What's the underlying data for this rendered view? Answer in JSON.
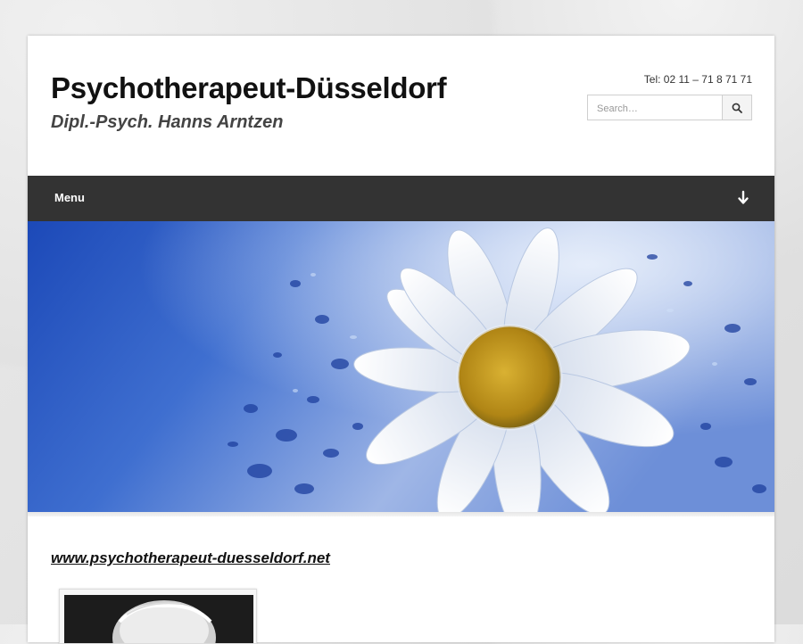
{
  "header": {
    "site_title": "Psychotherapeut-Düsseldorf",
    "site_description": "Dipl.-Psych. Hanns Arntzen",
    "phone": "Tel: 02 11 – 71 8 71 71"
  },
  "search": {
    "placeholder": "Search…",
    "value": "",
    "button_icon": "search-icon"
  },
  "nav": {
    "menu_label": "Menu",
    "toggle_icon": "arrow-down-icon"
  },
  "hero": {
    "image": "white-daisy-on-blue-water-drops"
  },
  "content": {
    "site_link": "www.psychotherapeut-duesseldorf.net",
    "photo": "portrait-black-and-white"
  },
  "colors": {
    "navbar": "#333333",
    "nav_text": "#ffffff",
    "title_text": "#111111",
    "description_text": "#444444",
    "hero_blue": "#2f5fc8"
  }
}
